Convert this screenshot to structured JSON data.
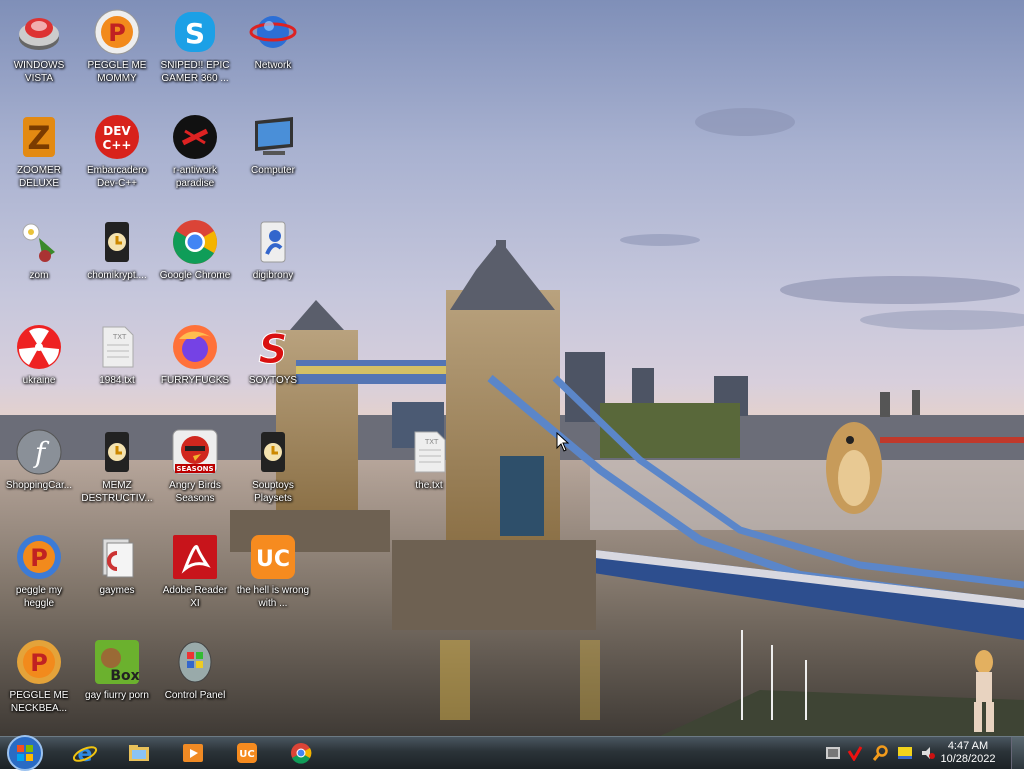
{
  "desktop": {
    "icons": [
      {
        "label": "WINDOWS VISTA",
        "icon": "windows-vista-icon"
      },
      {
        "label": "PEGGLE ME MOMMY",
        "icon": "peggle-icon"
      },
      {
        "label": "SNIPED!! EPIC GAMER 360 ...",
        "icon": "skype-icon"
      },
      {
        "label": "Network",
        "icon": "network-icon"
      },
      {
        "label": "ZOOMER DELUXE",
        "icon": "zuma-icon"
      },
      {
        "label": "Embarcadero Dev-C++",
        "icon": "devcpp-icon"
      },
      {
        "label": "r-antiwork paradise",
        "icon": "antiwork-icon"
      },
      {
        "label": "Computer",
        "icon": "computer-icon"
      },
      {
        "label": "zom",
        "icon": "zom-icon"
      },
      {
        "label": "chomikrypt....",
        "icon": "shortcut-file-icon"
      },
      {
        "label": "Google Chrome",
        "icon": "chrome-icon"
      },
      {
        "label": "digibrony",
        "icon": "digibrony-icon"
      },
      {
        "label": "ukraine",
        "icon": "radiation-icon"
      },
      {
        "label": "1984.txt",
        "icon": "text-file-icon"
      },
      {
        "label": "FURRYFUCKS",
        "icon": "firefox-icon"
      },
      {
        "label": "SOYTOYS",
        "icon": "soytoys-icon"
      },
      {
        "label": "ShoppingCar...",
        "icon": "flash-icon"
      },
      {
        "label": "MEMZ DESTRUCTIV...",
        "icon": "shortcut-file-icon"
      },
      {
        "label": "Angry Birds Seasons",
        "icon": "angry-birds-icon"
      },
      {
        "label": "Souptoys Playsets",
        "icon": "shortcut-file-icon"
      },
      {
        "label": "the.txt",
        "icon": "text-file-icon"
      },
      {
        "label": "peggle my heggle",
        "icon": "peggle-icon"
      },
      {
        "label": "gaymes",
        "icon": "folder-icon"
      },
      {
        "label": "Adobe Reader XI",
        "icon": "adobe-reader-icon"
      },
      {
        "label": "the hell is wrong with ...",
        "icon": "uc-browser-icon"
      },
      {
        "label": "PEGGLE ME NECKBEA...",
        "icon": "peggle-icon"
      },
      {
        "label": "gay fiurry porn",
        "icon": "box-icon"
      },
      {
        "label": "Control Panel",
        "icon": "control-panel-icon"
      }
    ]
  },
  "taskbar": {
    "pinned": [
      "internet-explorer-icon",
      "windows-explorer-icon",
      "media-player-icon",
      "uc-browser-icon",
      "chrome-icon"
    ],
    "tray": [
      "network-tray-icon",
      "antivirus-tray-icon",
      "search-tray-icon",
      "notes-tray-icon",
      "volume-tray-icon"
    ],
    "time": "4:47 AM",
    "date": "10/28/2022"
  }
}
